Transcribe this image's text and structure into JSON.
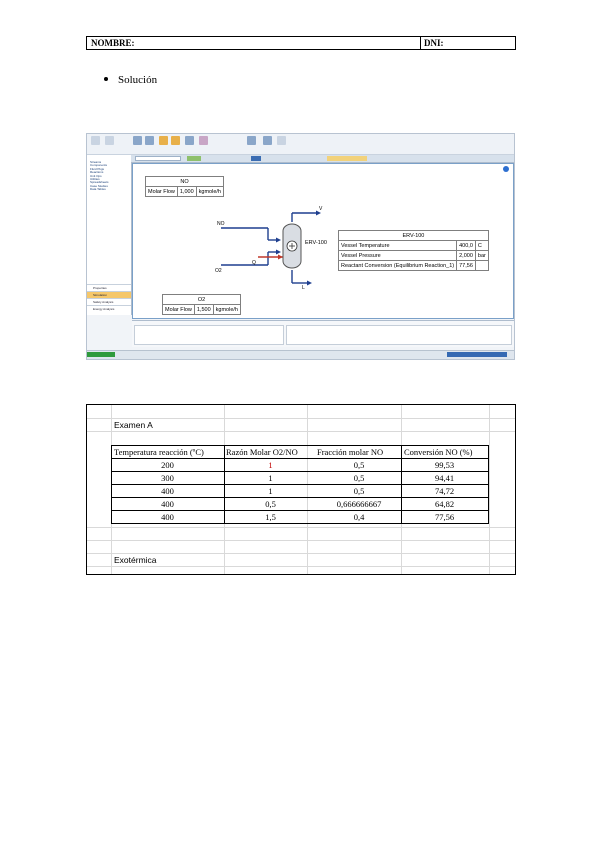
{
  "header": {
    "nombre_label": "NOMBRE:",
    "dni_label": "DNI:"
  },
  "section_title": "Solución",
  "simulator": {
    "left_tree": "Streams\nComponents\nFluid Pkgs\nReactions\nUnit Ops\nUtilities\nSpreadsheets\nCase Studies\nData Tables",
    "nav_buttons": [
      "Properties",
      "Simulation",
      "Safety Analysis",
      "Energy Analysis"
    ],
    "stream_no": {
      "title": "NO",
      "row_label": "Molar Flow",
      "value": "1,000",
      "unit": "kgmole/h"
    },
    "stream_o2": {
      "title": "O2",
      "row_label": "Molar Flow",
      "value": "1,500",
      "unit": "kgmole/h"
    },
    "labels": {
      "no": "NO",
      "o2": "O2",
      "v": "V",
      "l": "L",
      "q": "Q",
      "reactor": "ERV-100"
    },
    "reactor_table": {
      "title": "ERV-100",
      "rows": [
        {
          "label": "Vessel Temperature",
          "value": "400,0",
          "unit": "C"
        },
        {
          "label": "Vessel Pressure",
          "value": "2,000",
          "unit": "bar"
        },
        {
          "label": "Reactant Conversion (Equilibrium Reaction_1)",
          "value": "77,56",
          "unit": ""
        }
      ]
    },
    "colors": {
      "accent": "#2b5597",
      "stream_in": "#1f3f8f",
      "stream_energy": "#c0392b"
    }
  },
  "sheet": {
    "title": "Examen A",
    "headers": [
      "Temperatura reacción (ºC)",
      "Razón Molar O2/NO",
      "Fracción molar NO",
      "Conversión NO (%)"
    ],
    "rows": [
      {
        "temp": "200",
        "ratio": "1",
        "frac": "0,5",
        "conv": "99,53",
        "ratio_red": true
      },
      {
        "temp": "300",
        "ratio": "1",
        "frac": "0,5",
        "conv": "94,41",
        "ratio_red": false
      },
      {
        "temp": "400",
        "ratio": "1",
        "frac": "0,5",
        "conv": "74,72",
        "ratio_red": false
      },
      {
        "temp": "400",
        "ratio": "0,5",
        "frac": "0,666666667",
        "conv": "64,82",
        "ratio_red": false
      },
      {
        "temp": "400",
        "ratio": "1,5",
        "frac": "0,4",
        "conv": "77,56",
        "ratio_red": false
      }
    ],
    "note": "Exotérmica"
  }
}
